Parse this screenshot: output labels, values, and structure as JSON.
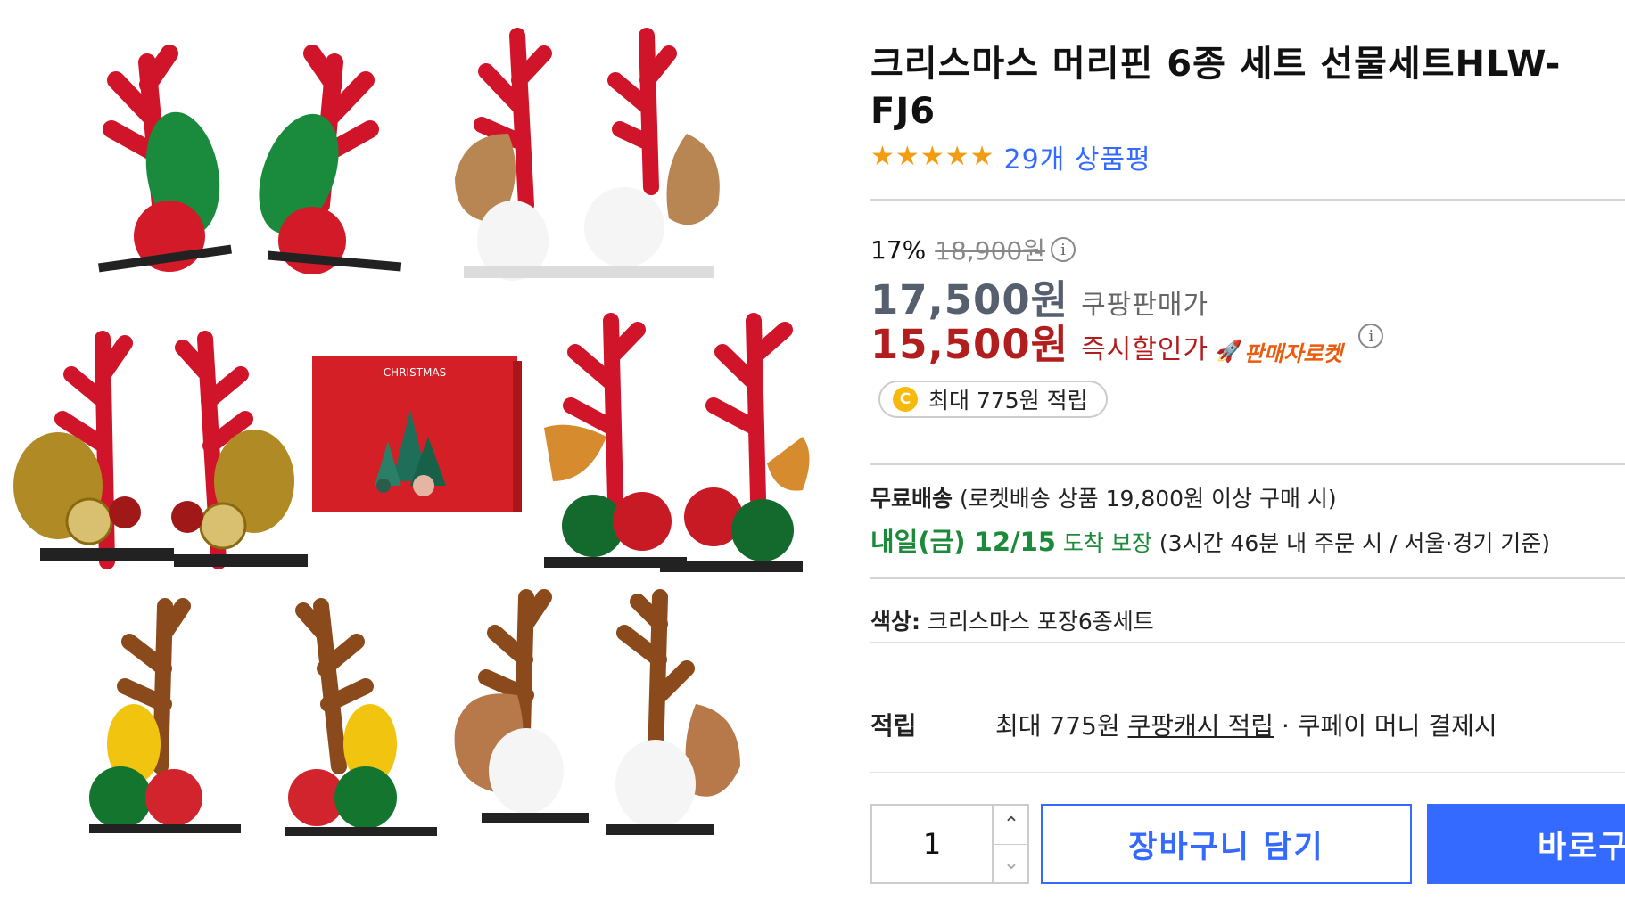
{
  "product": {
    "title": "크리스마스 머리핀 6종 세트 선물세트HLW-FJ6",
    "rating_stars": 5,
    "review_text": "29개 상품평"
  },
  "price": {
    "discount_rate": "17%",
    "original_price": "18,900원",
    "sale_price": "17,500원",
    "sale_label": "쿠팡판매가",
    "instant_price": "15,500원",
    "instant_label": "즉시할인가",
    "rocket_badge": "판매자로켓",
    "info_icon": "i"
  },
  "cash_reward": {
    "coin": "C",
    "text": "최대 775원 적립"
  },
  "shipping": {
    "free_label": "무료배송",
    "free_detail": "(로켓배송 상품 19,800원 이상 구매 시)",
    "date": "내일(금) 12/15",
    "guarantee": "도착 보장",
    "condition": "(3시간 46분  내 주문 시 / 서울·경기 기준)"
  },
  "option": {
    "label": "색상:",
    "value": "크리스마스 포장6종세트"
  },
  "reward": {
    "label": "적립",
    "prefix": "최대 775원",
    "link": "쿠팡캐시 적립",
    "suffix": "· 쿠페이 머니 결제시"
  },
  "purchase": {
    "quantity": "1",
    "cart_label": "장바구니 담기",
    "buy_label": "바로구매"
  },
  "image": {
    "box_text": "CHRISTMAS"
  },
  "colors": {
    "accent_blue": "#346aff",
    "instant_red": "#b21e1e",
    "delivery_green": "#1b8a3a",
    "star_orange": "#f39c0f"
  }
}
